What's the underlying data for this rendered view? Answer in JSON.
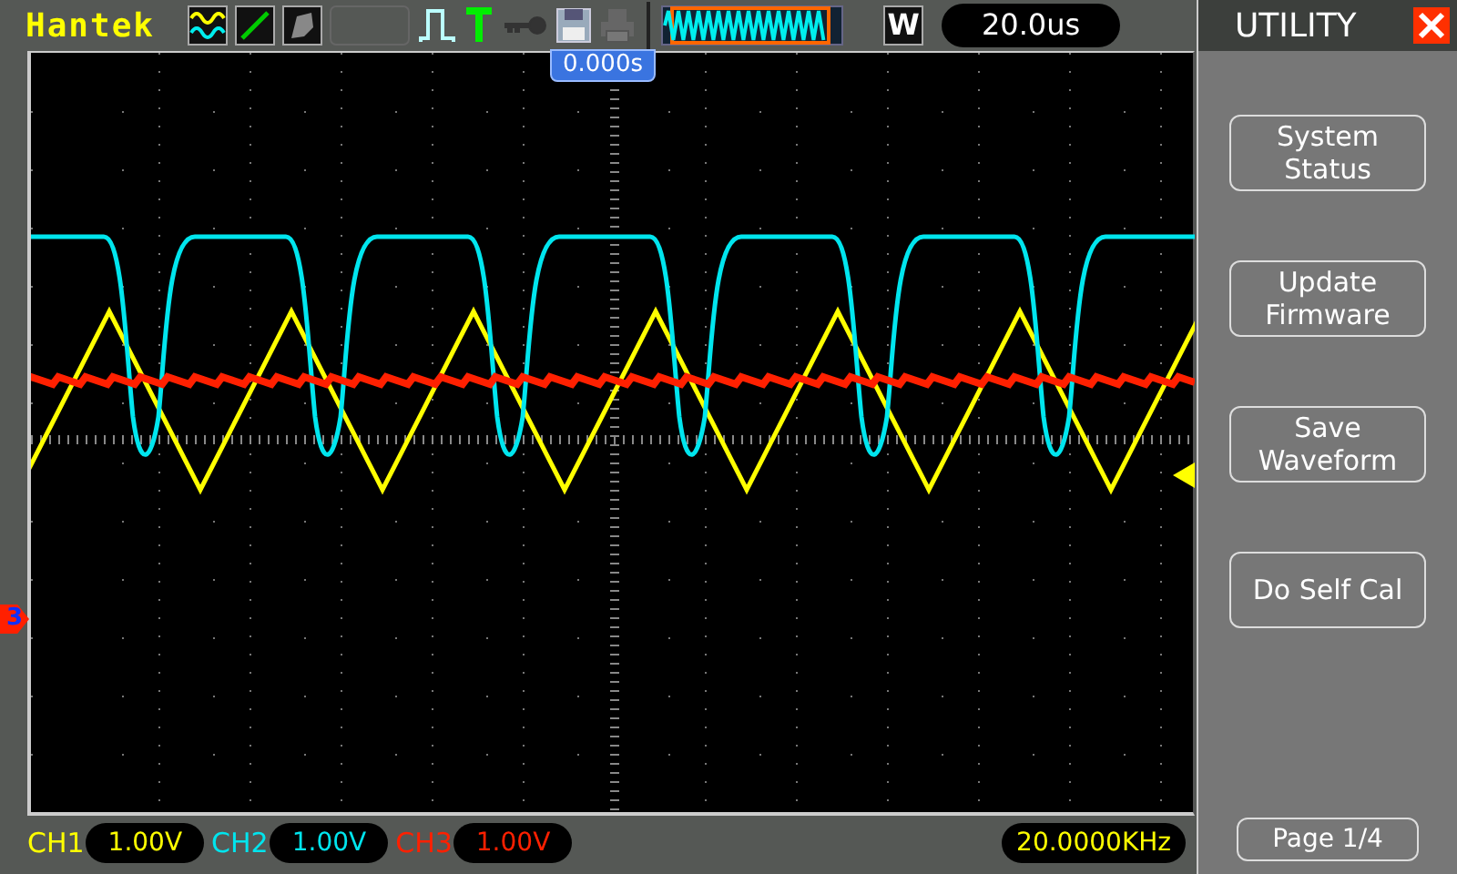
{
  "brand": "Hantek",
  "trigger_position": "0.000s",
  "timebase": {
    "label": "W",
    "value": "20.0us"
  },
  "channels": [
    {
      "name": "CH1",
      "scale": "1.00V",
      "color": "#ffff00",
      "kind": "triangle"
    },
    {
      "name": "CH2",
      "scale": "1.00V",
      "color": "#00e5ee",
      "kind": "trapezoid"
    },
    {
      "name": "CH3",
      "scale": "1.00V",
      "color": "#ff2000",
      "kind": "flat",
      "marker": "3"
    }
  ],
  "frequency": "20.0000KHz",
  "menu": {
    "title": "UTILITY",
    "buttons": [
      "System\nStatus",
      "Update\nFirmware",
      "Save\nWaveform",
      "Do Self Cal"
    ],
    "page": "Page 1/4"
  }
}
